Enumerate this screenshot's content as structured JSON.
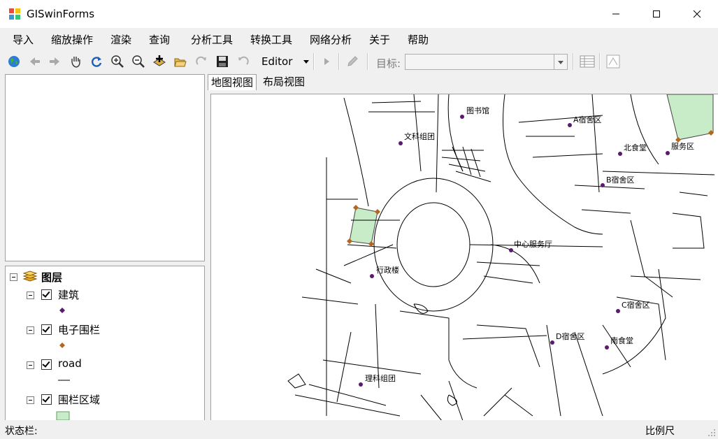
{
  "window": {
    "title": "GISwinForms"
  },
  "menu": [
    "导入",
    "缩放操作",
    "渲染",
    "查询",
    "分析工具",
    "转换工具",
    "网络分析",
    "关于",
    "帮助"
  ],
  "toolbar": {
    "editor_label": "Editor",
    "target_label": "目标:",
    "target_value": ""
  },
  "toc": {
    "root_label": "图层",
    "layers": [
      {
        "name": "建筑",
        "checked": true,
        "symbol": "purple-point",
        "color": "#5b1a6e"
      },
      {
        "name": "电子围栏",
        "checked": true,
        "symbol": "orange-point",
        "color": "#b5651d"
      },
      {
        "name": "road",
        "checked": true,
        "symbol": "black-line",
        "color": "#000000"
      },
      {
        "name": "围栏区域",
        "checked": true,
        "symbol": "green-fill",
        "color": "#c8ebc8"
      }
    ]
  },
  "tabs": [
    "地图视图",
    "布局视图"
  ],
  "map": {
    "labels": [
      "图书馆",
      "A宿舍区",
      "文科组团",
      "北食堂",
      "服务区",
      "B宿舍区",
      "中心服务厅",
      "行政楼",
      "C宿舍区",
      "D宿舍区",
      "南食堂",
      "理科组团"
    ]
  },
  "status": {
    "left": "状态栏:",
    "right": "比例尺"
  }
}
